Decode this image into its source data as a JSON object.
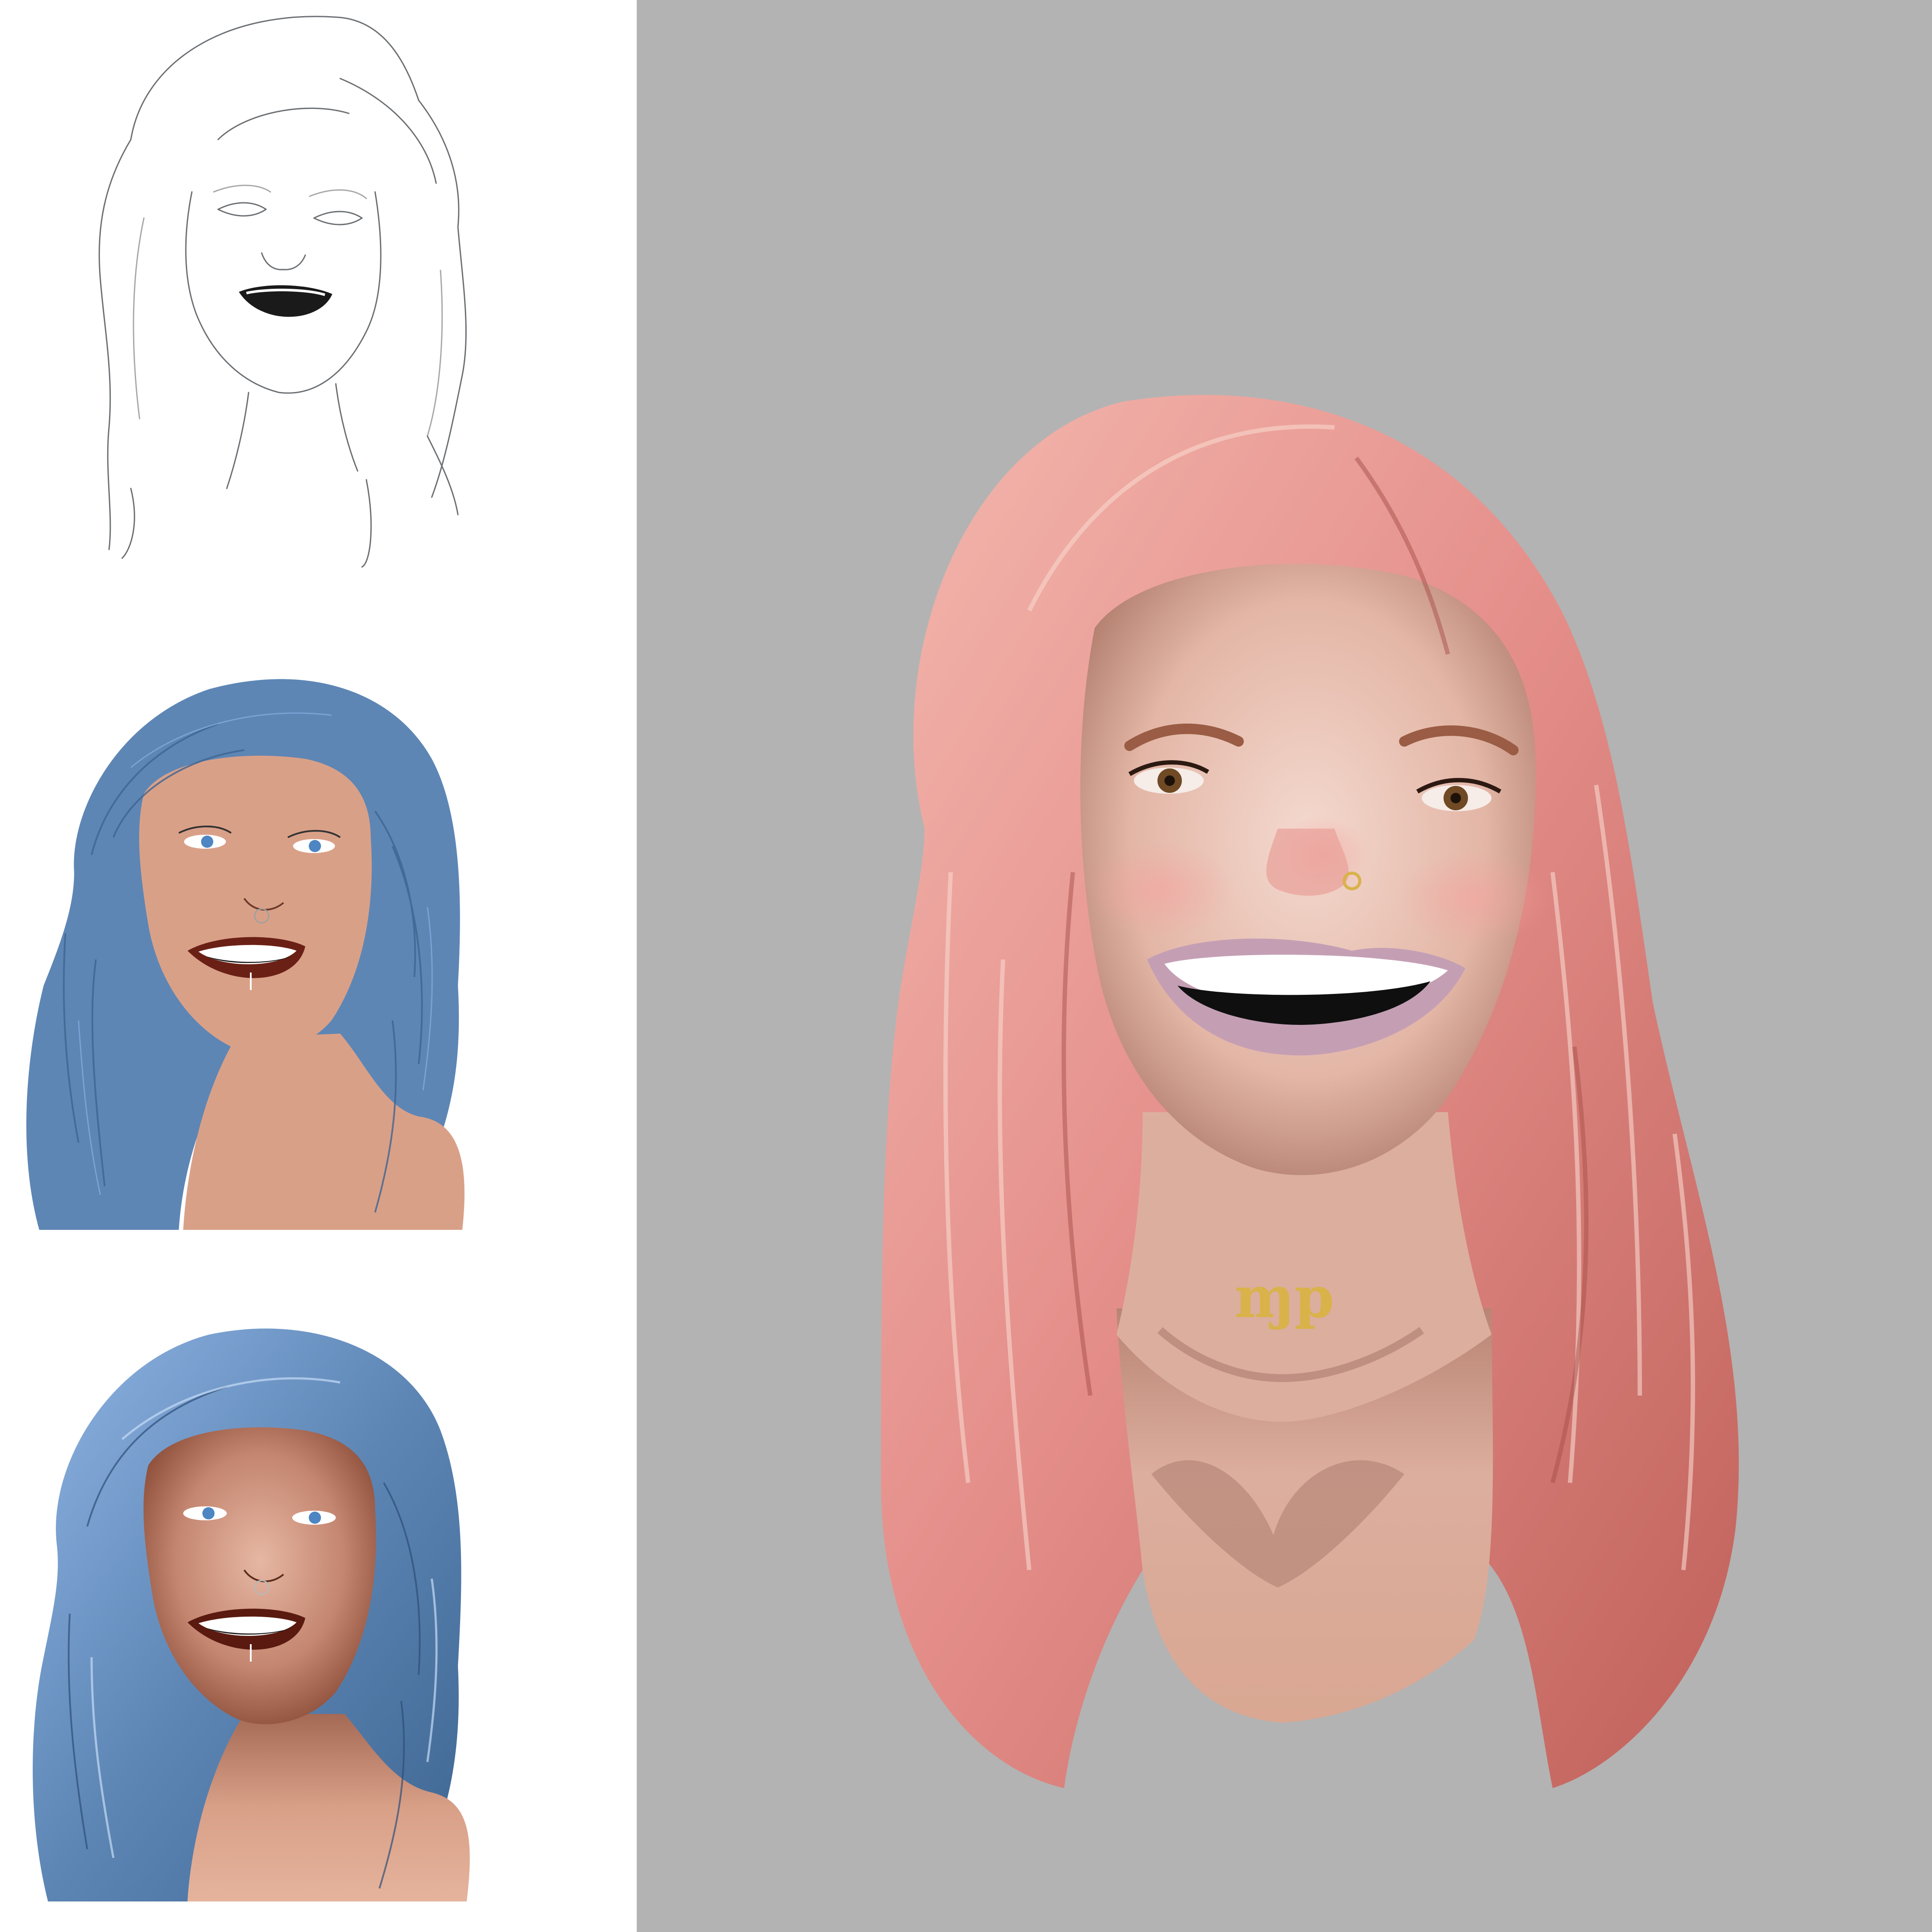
{
  "artwork": {
    "layout": "progress-sheet",
    "stages": [
      {
        "id": "sketch",
        "style": "line-art"
      },
      {
        "id": "flat",
        "style": "flat-color"
      },
      {
        "id": "shaded",
        "style": "partial-shading"
      },
      {
        "id": "final",
        "style": "full-render"
      }
    ],
    "pendant_glyph": "ɱp"
  },
  "colors": {
    "page_bg": "#ffffff",
    "final_bg": "#b3b3b3",
    "sketch_line": "#3a3f44",
    "blue_hair": "#5d86b5",
    "blue_hair_dark": "#3e6591",
    "blue_hair_light": "#88aee0",
    "flat_skin": "#d9a088",
    "shaded_skin_dark": "#9a5a42",
    "lips_flat": "#6b2015",
    "pink_hair": "#e58f8b",
    "pink_hair_light": "#f5c4b8",
    "pink_hair_dark": "#c0615a",
    "final_skin": "#e7c0b2",
    "final_skin_shadow": "#a8776a",
    "lips_final": "#c49fb4",
    "eye_brown": "#6f4a24",
    "eye_blue": "#4d86c2",
    "gold": "#d9b24a"
  }
}
